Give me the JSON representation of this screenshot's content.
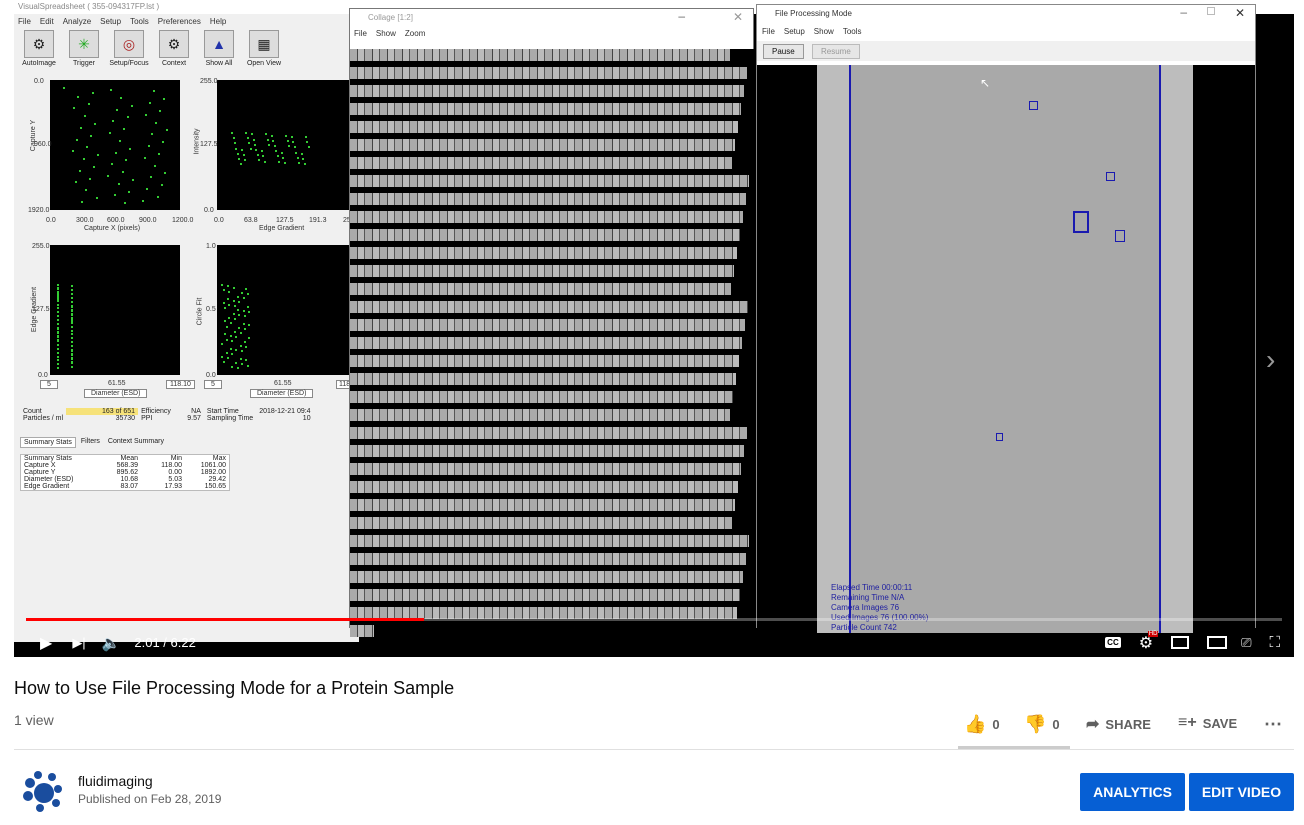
{
  "vs": {
    "title": "VisualSpreadsheet ( 355-094317FP.lst )",
    "menu": [
      "File",
      "Edit",
      "Analyze",
      "Setup",
      "Tools",
      "Preferences",
      "Help"
    ],
    "toolbar": [
      "AutoImage",
      "Trigger",
      "Setup/Focus",
      "Context",
      "Show All",
      "Open View"
    ],
    "plot1": {
      "ytop": "0.0",
      "ymid": "960.0",
      "ybot": "1920.0",
      "ylabel": "Capture Y",
      "xticks": [
        "0.0",
        "300.0",
        "600.0",
        "900.0",
        "1200.0"
      ],
      "xlabel": "Capture X (pixels)"
    },
    "plot2": {
      "ytop": "255.0",
      "ymid": "127.5",
      "ybot": "0.0",
      "ylabel": "Intensity",
      "xticks": [
        "0.0",
        "63.8",
        "127.5",
        "191.3",
        "25"
      ],
      "xlabel": "Edge Gradient"
    },
    "plot3": {
      "ytop": "255.0",
      "ymid": "127.5",
      "ybot": "0.0",
      "ylabel": "Edge Gradient",
      "xmin": "5",
      "xmid": "61.55",
      "xmax": "118.10",
      "xlabel": "Diameter (ESD)"
    },
    "plot4": {
      "ytop": "1.0",
      "ymid": "0.5",
      "ybot": "0.0",
      "ylabel": "Circle Fit",
      "xmin": "5",
      "xmid": "61.55",
      "xmax": "118",
      "xlabel": "Diameter (ESD)"
    },
    "count_label": "Count",
    "count_value": "163  of  651",
    "efficiency_label": "Efficiency",
    "efficiency_value": "NA",
    "start_label": "Start Time",
    "start_value": "2018-12-21 09:4",
    "ppml_label": "Particles / ml",
    "ppml_value": "35730",
    "ppi_label": "PPI",
    "ppi_value": "9.57",
    "sampling_label": "Sampling Time",
    "sampling_value": "10",
    "tabs": [
      "Summary Stats",
      "Filters",
      "Context Summary"
    ],
    "stats_header": [
      "Summary Stats",
      "Mean",
      "Min",
      "Max"
    ],
    "stats_rows": [
      [
        "Capture X",
        "568.39",
        "118.00",
        "1061.00"
      ],
      [
        "Capture Y",
        "895.62",
        "0.00",
        "1892.00"
      ],
      [
        "Diameter (ESD)",
        "10.68",
        "5.03",
        "29.42"
      ],
      [
        "Edge Gradient",
        "83.07",
        "17.93",
        "150.65"
      ]
    ]
  },
  "collage": {
    "title": "Collage  [1:2]",
    "menu": [
      "File",
      "Show",
      "Zoom"
    ]
  },
  "fpm": {
    "title": "File Processing Mode",
    "menu": [
      "File",
      "Setup",
      "Show",
      "Tools"
    ],
    "pause": "Pause",
    "resume": "Resume",
    "overlay": [
      "Elapsed Time  00:00:11",
      "Remaining Time  N/A",
      "Camera Images  76",
      "Used Images  76  (100.00%)",
      "Particle Count  742"
    ]
  },
  "player": {
    "time": "2:01 / 6:22",
    "progress": 0.317,
    "cc": "CC",
    "hd": "HD"
  },
  "video": {
    "title": "How to Use File Processing Mode for a Protein Sample",
    "views": "1 view",
    "likes": "0",
    "dislikes": "0",
    "share": "SHARE",
    "save": "SAVE",
    "channel": "fluidimaging",
    "published": "Published on Feb 28, 2019",
    "analytics": "ANALYTICS",
    "edit": "EDIT VIDEO"
  },
  "colors": {
    "accent": "#065fd4",
    "progress": "#ff0000",
    "overlay_text": "#2020a0"
  }
}
